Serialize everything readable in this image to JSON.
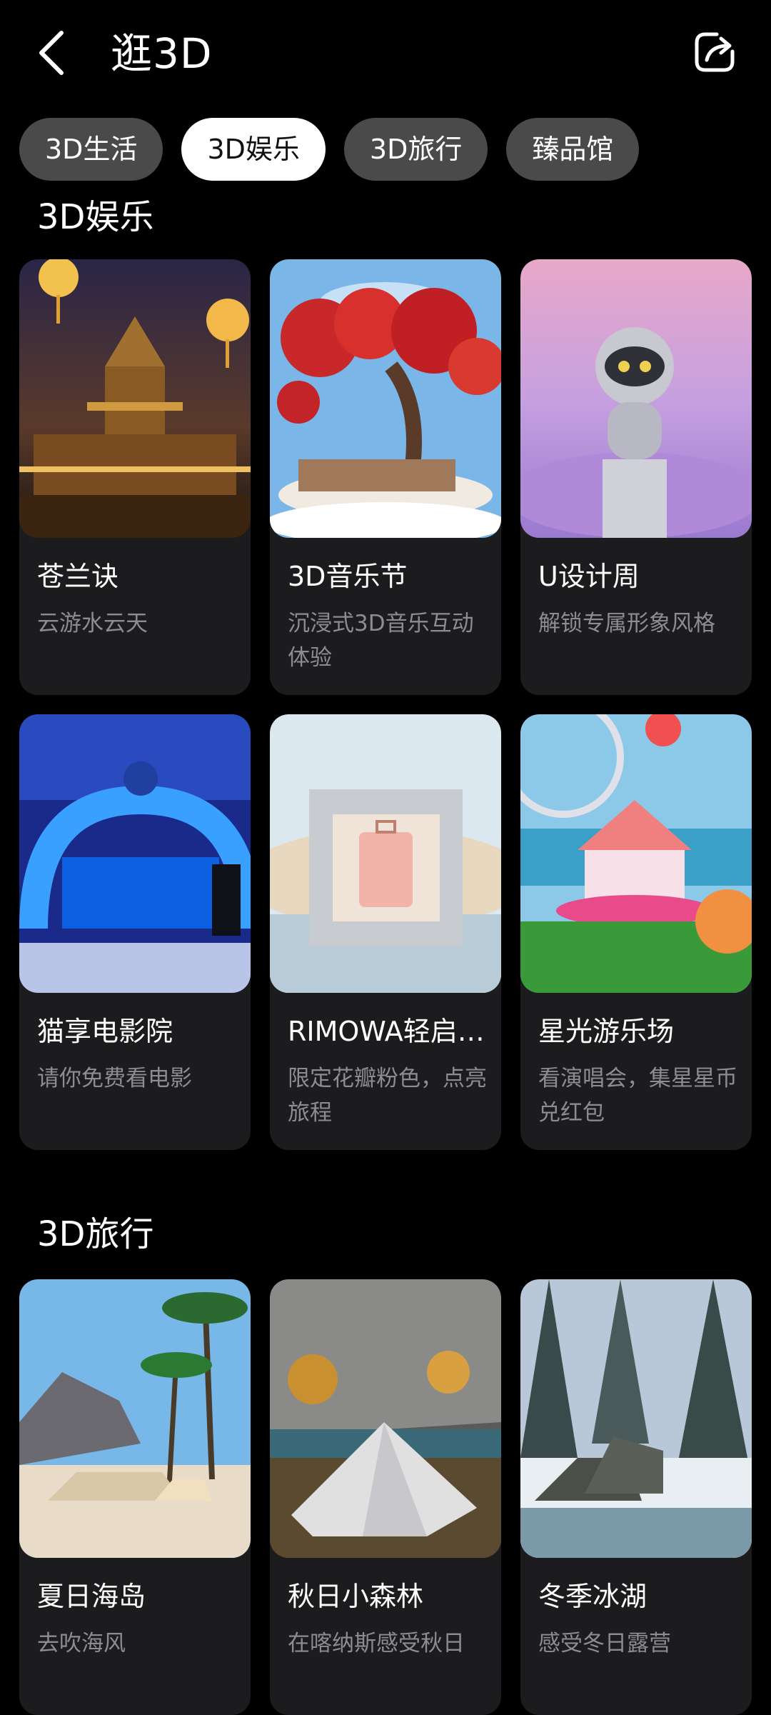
{
  "header": {
    "title": "逛3D",
    "back_icon": "back-arrow-icon",
    "share_icon": "share-icon"
  },
  "tabs": [
    {
      "label": "3D生活",
      "active": false
    },
    {
      "label": "3D娱乐",
      "active": true
    },
    {
      "label": "3D旅行",
      "active": false
    },
    {
      "label": "臻品馆",
      "active": false
    }
  ],
  "sections": [
    {
      "title": "3D娱乐",
      "cards": [
        {
          "title": "苍兰诀",
          "subtitle": "云游水云天"
        },
        {
          "title": "3D音乐节",
          "subtitle": "沉浸式3D音乐互动体验"
        },
        {
          "title": "U设计周",
          "subtitle": "解锁专属形象风格"
        },
        {
          "title": "猫享电影院",
          "subtitle": "请你免费看电影"
        },
        {
          "title": "RIMOWA轻启…",
          "subtitle": "限定花瓣粉色，点亮旅程"
        },
        {
          "title": "星光游乐场",
          "subtitle": "看演唱会，集星星币兑红包"
        }
      ]
    },
    {
      "title": "3D旅行",
      "cards": [
        {
          "title": "夏日海岛",
          "subtitle": "去吹海风"
        },
        {
          "title": "秋日小森林",
          "subtitle": "在喀纳斯感受秋日"
        },
        {
          "title": "冬季冰湖",
          "subtitle": "感受冬日露营"
        }
      ]
    }
  ],
  "colors": {
    "background": "#000000",
    "card": "#1c1c1e",
    "tab_inactive": "#4a4a4a",
    "tab_active": "#ffffff",
    "subtitle": "#8d8d8f"
  }
}
